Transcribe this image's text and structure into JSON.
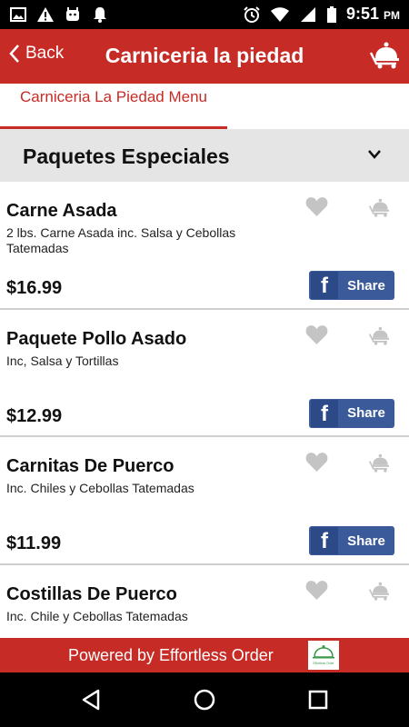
{
  "status_bar": {
    "time": "9:51",
    "ampm": "PM"
  },
  "header": {
    "back_label": "Back",
    "title": "Carniceria la piedad"
  },
  "tab": {
    "label": "Carniceria La Piedad Menu"
  },
  "section": {
    "title": "Paquetes Especiales"
  },
  "items": [
    {
      "name": "Carne Asada",
      "description": "2 lbs. Carne Asada inc. Salsa y Cebollas Tatemadas",
      "price": "$16.99",
      "share_label": "Share"
    },
    {
      "name": "Paquete Pollo Asado",
      "description": "Inc, Salsa y Tortillas",
      "price": "$12.99",
      "share_label": "Share"
    },
    {
      "name": "Carnitas De Puerco",
      "description": "Inc. Chiles y Cebollas Tatemadas",
      "price": "$11.99",
      "share_label": "Share"
    },
    {
      "name": "Costillas De Puerco",
      "description": "Inc. Chile y Cebollas Tatemadas",
      "price": "",
      "share_label": ""
    }
  ],
  "footer": {
    "powered_text": "Powered by Effortless Order",
    "logo_caption": "Effortless Order"
  },
  "colors": {
    "brand_red": "#c62b26",
    "facebook_blue": "#3b5a9a",
    "section_gray": "#e5e5e5"
  }
}
